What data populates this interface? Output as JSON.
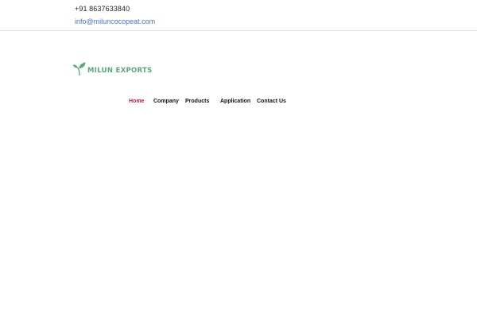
{
  "topbar": {
    "phone": "+91 8637633840",
    "email": "info@miluncocopeat.com"
  },
  "logo": {
    "text": "MILUN EXPORTS",
    "icon": "leaf-sprout-icon",
    "color": "#5aa87a"
  },
  "nav": {
    "items": [
      {
        "label": "Home",
        "active": true
      },
      {
        "label": "Company",
        "active": false
      },
      {
        "label": "Products",
        "active": false
      },
      {
        "label": "Application",
        "active": false
      },
      {
        "label": "Contact Us",
        "active": false
      }
    ],
    "active_color": "#c2185b"
  }
}
